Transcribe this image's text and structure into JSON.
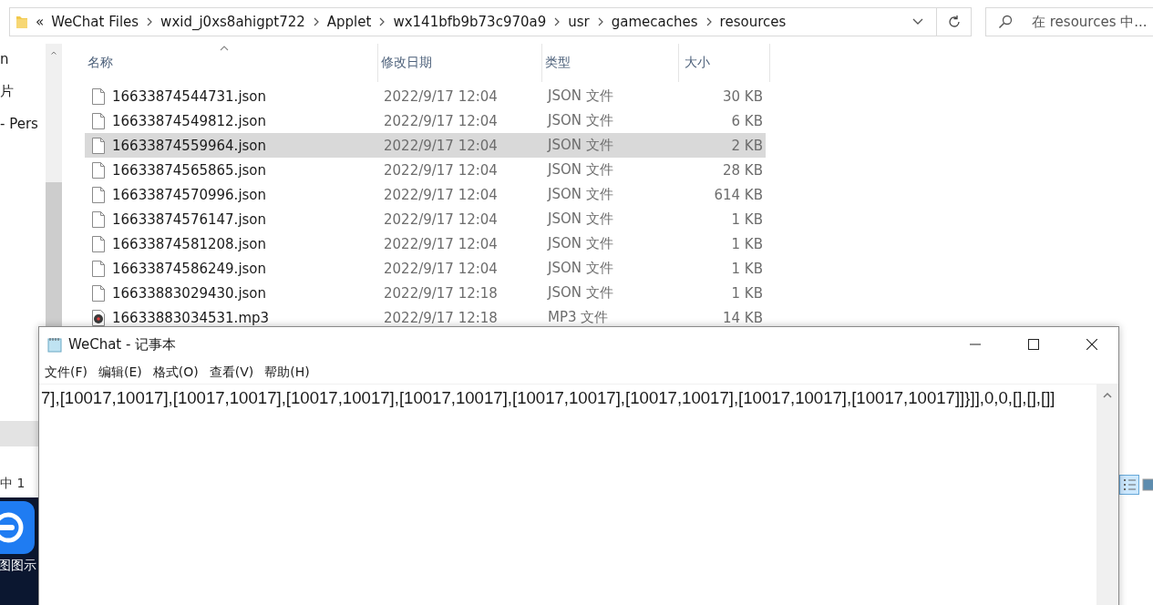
{
  "explorer": {
    "back_chevron": "«",
    "breadcrumb": [
      "WeChat Files",
      "wxid_j0xs8ahigpt722",
      "Applet",
      "wx141bfb9b73c970a9",
      "usr",
      "gamecaches",
      "resources"
    ],
    "search": {
      "placeholder": "在 resources 中..."
    },
    "nav_items": [
      "n",
      "片",
      "- Pers"
    ],
    "columns": [
      {
        "label": "名称",
        "sorted": true
      },
      {
        "label": "修改日期",
        "sorted": false
      },
      {
        "label": "类型",
        "sorted": false
      },
      {
        "label": "大小",
        "sorted": false
      }
    ],
    "files": [
      {
        "name": "16633874544731.json",
        "date": "2022/9/17 12:04",
        "type": "JSON 文件",
        "size": "30 KB",
        "kind": "json",
        "selected": false
      },
      {
        "name": "16633874549812.json",
        "date": "2022/9/17 12:04",
        "type": "JSON 文件",
        "size": "6 KB",
        "kind": "json",
        "selected": false
      },
      {
        "name": "16633874559964.json",
        "date": "2022/9/17 12:04",
        "type": "JSON 文件",
        "size": "2 KB",
        "kind": "json",
        "selected": true
      },
      {
        "name": "16633874565865.json",
        "date": "2022/9/17 12:04",
        "type": "JSON 文件",
        "size": "28 KB",
        "kind": "json",
        "selected": false
      },
      {
        "name": "16633874570996.json",
        "date": "2022/9/17 12:04",
        "type": "JSON 文件",
        "size": "614 KB",
        "kind": "json",
        "selected": false
      },
      {
        "name": "16633874576147.json",
        "date": "2022/9/17 12:04",
        "type": "JSON 文件",
        "size": "1 KB",
        "kind": "json",
        "selected": false
      },
      {
        "name": "16633874581208.json",
        "date": "2022/9/17 12:04",
        "type": "JSON 文件",
        "size": "1 KB",
        "kind": "json",
        "selected": false
      },
      {
        "name": "16633874586249.json",
        "date": "2022/9/17 12:04",
        "type": "JSON 文件",
        "size": "1 KB",
        "kind": "json",
        "selected": false
      },
      {
        "name": "16633883029430.json",
        "date": "2022/9/17 12:18",
        "type": "JSON 文件",
        "size": "1 KB",
        "kind": "json",
        "selected": false
      },
      {
        "name": "16633883034531.mp3",
        "date": "2022/9/17 12:18",
        "type": "MP3 文件",
        "size": "14 KB",
        "kind": "audio",
        "selected": false
      }
    ],
    "status": "中 1"
  },
  "desktop_icon": {
    "label": "图图示"
  },
  "notepad": {
    "title": "WeChat - 记事本",
    "menu": [
      "文件(F)",
      "编辑(E)",
      "格式(O)",
      "查看(V)",
      "帮助(H)"
    ],
    "text": "7],[10017,10017],[10017,10017],[10017,10017],[10017,10017],[10017,10017],[10017,10017],[10017,10017],[10017,10017]]}]],0,0,[],[],[]]"
  }
}
